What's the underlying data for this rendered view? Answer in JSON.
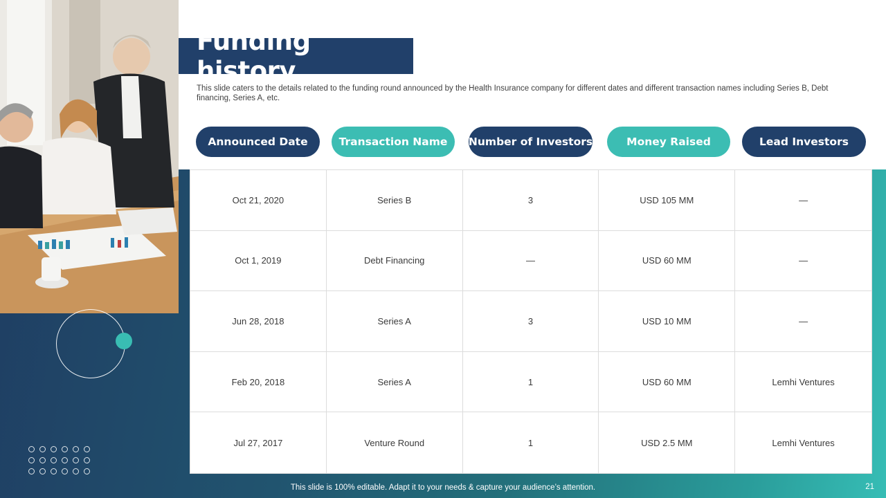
{
  "title": "Funding history",
  "subtitle": "This slide caters to the details related to the funding round announced by the Health Insurance company for different dates and different transaction names including Series B, Debt financing, Series A, etc.",
  "columns": [
    {
      "label": "Announced Date",
      "style": "dark"
    },
    {
      "label": "Transaction Name",
      "style": "teal"
    },
    {
      "label": "Number of Investors",
      "style": "dark"
    },
    {
      "label": "Money Raised",
      "style": "teal"
    },
    {
      "label": "Lead Investors",
      "style": "dark"
    }
  ],
  "rows": [
    [
      "Oct 21, 2020",
      "Series B",
      "3",
      "USD 105 MM",
      "—"
    ],
    [
      "Oct 1, 2019",
      "Debt Financing",
      "—",
      "USD 60 MM",
      "—"
    ],
    [
      "Jun 28, 2018",
      "Series A",
      "3",
      "USD 10 MM",
      "—"
    ],
    [
      "Feb 20, 2018",
      "Series A",
      "1",
      "USD 60 MM",
      "Lemhi Ventures"
    ],
    [
      "Jul 27, 2017",
      "Venture Round",
      "1",
      "USD 2.5 MM",
      "Lemhi Ventures"
    ]
  ],
  "footer": "This slide is 100% editable. Adapt it to your needs & capture your audience’s attention.",
  "page_number": "21",
  "colors": {
    "navy": "#21406a",
    "teal": "#3cbdb3"
  },
  "photo": {
    "icon": "business-meeting-photo"
  }
}
